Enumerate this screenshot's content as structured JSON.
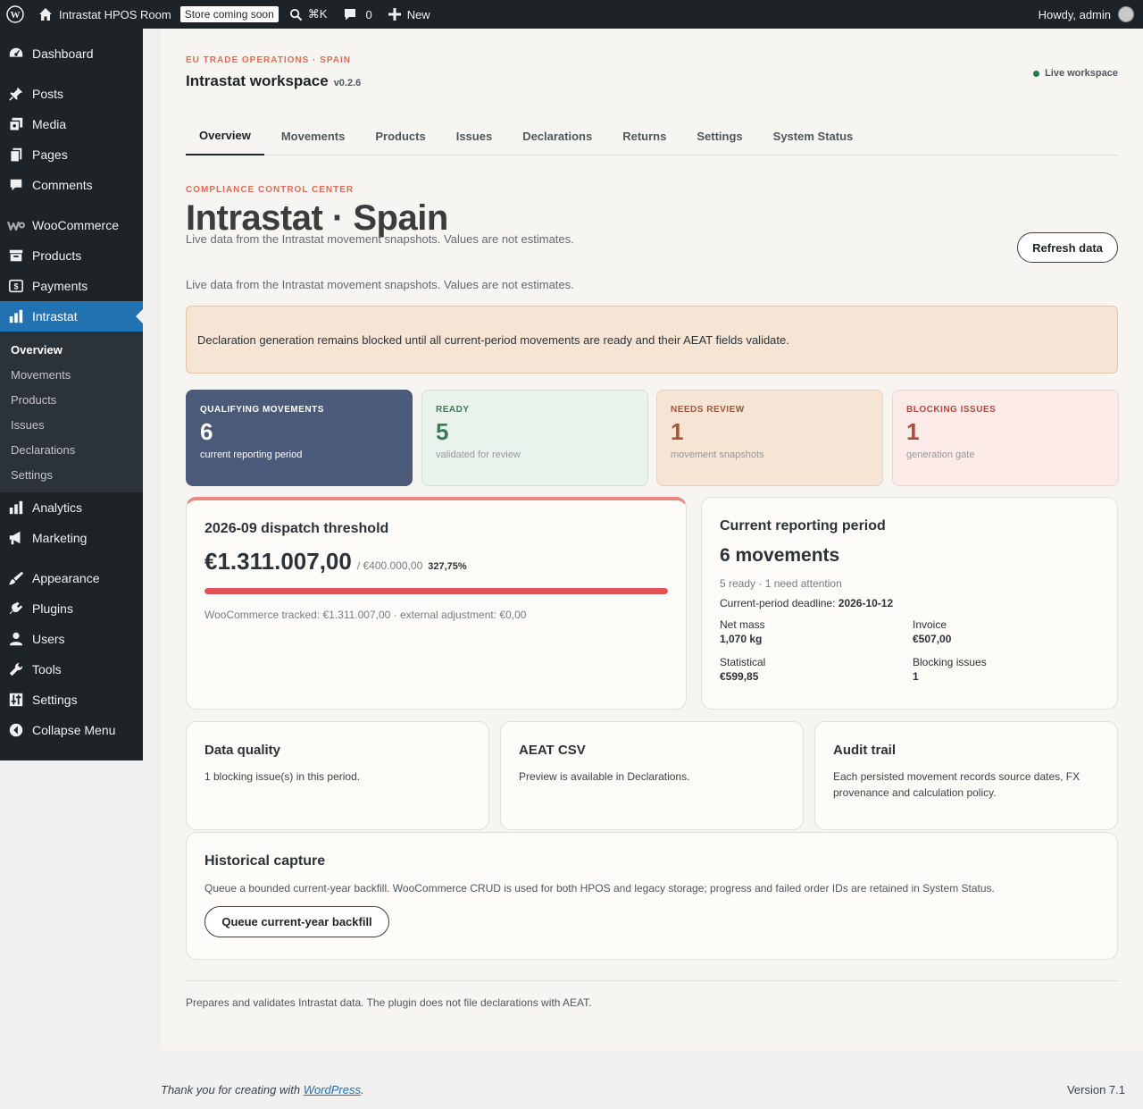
{
  "adminbar": {
    "site_name": "Intrastat HPOS Room",
    "store_badge": "Store coming soon",
    "shortcut": "⌘K",
    "comments_count": "0",
    "new_label": "New",
    "howdy": "Howdy, admin"
  },
  "sidebar": {
    "items": [
      {
        "label": "Dashboard",
        "icon": "dashboard-icon"
      },
      {
        "label": "Posts",
        "icon": "pin-icon"
      },
      {
        "label": "Media",
        "icon": "media-icon"
      },
      {
        "label": "Pages",
        "icon": "pages-icon"
      },
      {
        "label": "Comments",
        "icon": "comments-icon"
      },
      {
        "label": "WooCommerce",
        "icon": "woocommerce-icon"
      },
      {
        "label": "Products",
        "icon": "archive-icon"
      },
      {
        "label": "Payments",
        "icon": "payments-icon"
      },
      {
        "label": "Intrastat",
        "icon": "chart-bar-icon"
      },
      {
        "label": "Analytics",
        "icon": "analytics-icon"
      },
      {
        "label": "Marketing",
        "icon": "megaphone-icon"
      },
      {
        "label": "Appearance",
        "icon": "brush-icon"
      },
      {
        "label": "Plugins",
        "icon": "plugin-icon"
      },
      {
        "label": "Users",
        "icon": "users-icon"
      },
      {
        "label": "Tools",
        "icon": "wrench-icon"
      },
      {
        "label": "Settings",
        "icon": "settings-icon"
      },
      {
        "label": "Collapse Menu",
        "icon": "collapse-icon"
      }
    ],
    "submenu": [
      "Overview",
      "Movements",
      "Products",
      "Issues",
      "Declarations",
      "Settings"
    ]
  },
  "header": {
    "eyebrow": "EU TRADE OPERATIONS · SPAIN",
    "title": "Intrastat workspace",
    "version": "v0.2.6",
    "status": "Live workspace"
  },
  "tabs": [
    "Overview",
    "Movements",
    "Products",
    "Issues",
    "Declarations",
    "Returns",
    "Settings",
    "System Status"
  ],
  "hero": {
    "eyebrow": "COMPLIANCE CONTROL CENTER",
    "title": "Intrastat · Spain",
    "subtitle": "Live data from the Intrastat movement snapshots. Values are not estimates.",
    "refresh_label": "Refresh data",
    "subtitle_repeat": "Live data from the Intrastat movement snapshots. Values are not estimates."
  },
  "notice": "Declaration generation remains blocked until all current-period movements are ready and their AEAT fields validate.",
  "stats": [
    {
      "label": "QUALIFYING MOVEMENTS",
      "value": "6",
      "sub": "current reporting period",
      "bg": "#4a5a78",
      "fg": "#ffffff"
    },
    {
      "label": "READY",
      "value": "5",
      "sub": "validated for review",
      "bg": "#eaf2ec",
      "fg": "#3d7a57"
    },
    {
      "label": "NEEDS REVIEW",
      "value": "1",
      "sub": "movement snapshots",
      "bg": "#f6e4d5",
      "fg": "#a0563a"
    },
    {
      "label": "BLOCKING ISSUES",
      "value": "1",
      "sub": "generation gate",
      "bg": "#fcebe8",
      "fg": "#b04a3d"
    }
  ],
  "threshold": {
    "title": "2026-09 dispatch threshold",
    "amount": "€1.311.007,00",
    "limit": "/ €400.000,00",
    "percent": "327,75%",
    "fill_fraction": 1.0,
    "bar_color": "#e05252",
    "note": "WooCommerce tracked: €1.311.007,00 · external adjustment: €0,00"
  },
  "period": {
    "title": "Current reporting period",
    "count": "6 movements",
    "summary": "5 ready · 1 need attention",
    "deadline_label": "Current-period deadline:",
    "deadline": "2026-10-12",
    "net_mass_label": "Net mass",
    "net_mass": "1,070 kg",
    "invoice_label": "Invoice",
    "invoice": "€507,00",
    "statistical_label": "Statistical",
    "statistical": "€599,85",
    "blocking_label": "Blocking issues",
    "blocking": "1"
  },
  "info_cards": [
    {
      "title": "Data quality",
      "text": "1 blocking issue(s) in this period."
    },
    {
      "title": "AEAT CSV",
      "text": "Preview is available in Declarations."
    },
    {
      "title": "Audit trail",
      "text": "Each persisted movement records source dates, FX provenance and calculation policy."
    }
  ],
  "historical": {
    "title": "Historical capture",
    "text": "Queue a bounded current-year backfill. WooCommerce CRUD is used for both HPOS and legacy storage; progress and failed order IDs are retained in System Status.",
    "button": "Queue current-year backfill"
  },
  "page_footer": "Prepares and validates Intrastat data. The plugin does not file declarations with AEAT.",
  "wp_footer": {
    "thanks_prefix": "Thank you for creating with ",
    "link": "WordPress",
    "suffix": ".",
    "version": "Version 7.1"
  }
}
